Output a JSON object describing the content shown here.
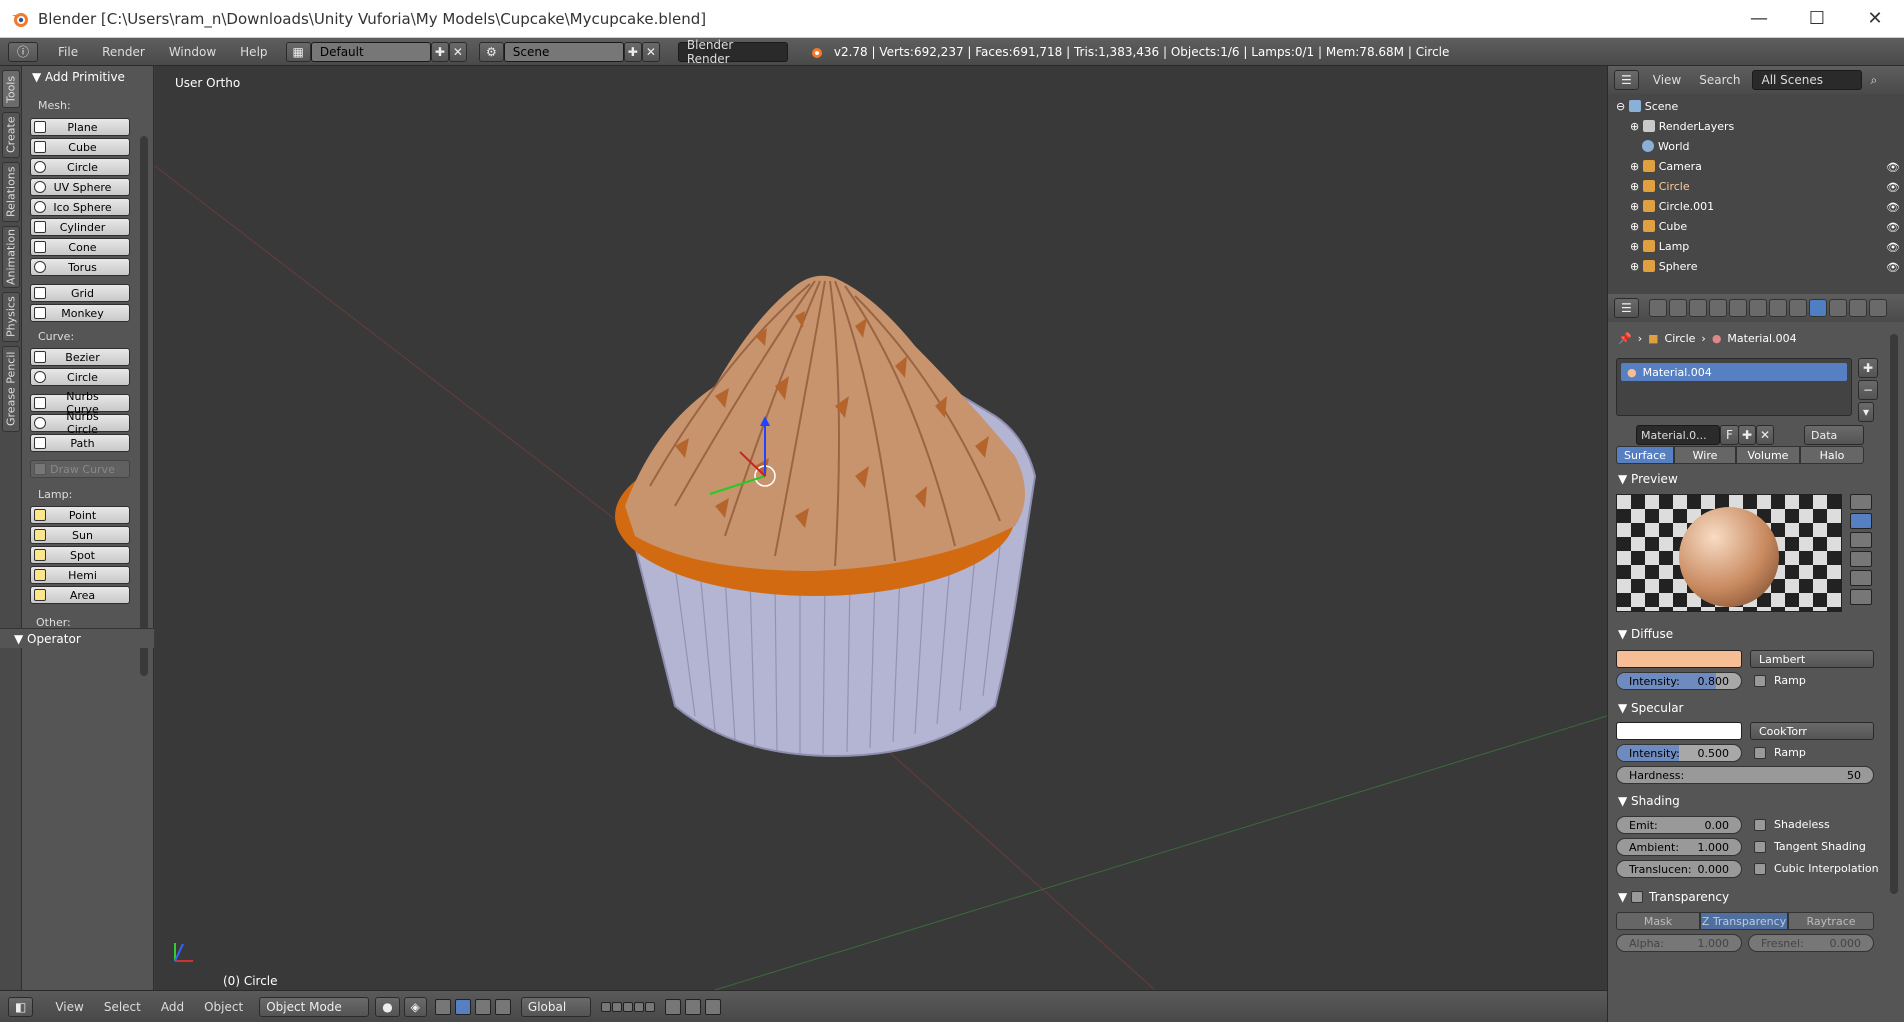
{
  "window": {
    "title": "Blender [C:\\Users\\ram_n\\Downloads\\Unity Vuforia\\My Models\\Cupcake\\Mycupcake.blend]",
    "minimize": "—",
    "maximize": "☐",
    "close": "✕"
  },
  "info_header": {
    "menus": [
      "File",
      "Render",
      "Window",
      "Help"
    ],
    "layout": "Default",
    "scene": "Scene",
    "engine": "Blender Render",
    "stats": "v2.78 | Verts:692,237 | Faces:691,718 | Tris:1,383,436 | Objects:1/6 | Lamps:0/1 | Mem:78.68M | Circle"
  },
  "tool_tabs": [
    "Tools",
    "Create",
    "Relations",
    "Animation",
    "Physics",
    "Grease Pencil"
  ],
  "tool_shelf": {
    "section": "Add Primitive",
    "mesh_label": "Mesh:",
    "mesh": [
      "Plane",
      "Cube",
      "Circle",
      "UV Sphere",
      "Ico Sphere",
      "Cylinder",
      "Cone",
      "Torus",
      "Grid",
      "Monkey"
    ],
    "curve_label": "Curve:",
    "curve": [
      "Bezier",
      "Circle",
      "Nurbs Curve",
      "Nurbs Circle",
      "Path"
    ],
    "draw_curve": "Draw Curve",
    "lamp_label": "Lamp:",
    "lamp": [
      "Point",
      "Sun",
      "Spot",
      "Hemi",
      "Area"
    ],
    "other_label": "Other:",
    "operator": "Operator"
  },
  "viewport": {
    "view_label": "User Ortho",
    "object_label": "(0) Circle"
  },
  "footer": {
    "menus": [
      "View",
      "Select",
      "Add",
      "Object"
    ],
    "mode": "Object Mode",
    "orientation": "Global"
  },
  "outliner": {
    "menus": [
      "View",
      "Search"
    ],
    "scenes": "All Scenes",
    "items": [
      {
        "name": "Scene",
        "color": "#8ab0d8"
      },
      {
        "name": "RenderLayers",
        "color": "#c9c9c9"
      },
      {
        "name": "World",
        "color": "#8ab0d8"
      },
      {
        "name": "Camera",
        "color": "#e0a040"
      },
      {
        "name": "Circle",
        "color": "#e0a040"
      },
      {
        "name": "Circle.001",
        "color": "#e0a040"
      },
      {
        "name": "Cube",
        "color": "#e0a040"
      },
      {
        "name": "Lamp",
        "color": "#e0a040"
      },
      {
        "name": "Sphere",
        "color": "#e0a040"
      }
    ]
  },
  "properties": {
    "breadcrumb_object": "Circle",
    "breadcrumb_material": "Material.004",
    "material_slot": "Material.004",
    "material_field": "Material.0...",
    "fake_user": "F",
    "link": "Data",
    "tabs": [
      "Surface",
      "Wire",
      "Volume",
      "Halo"
    ],
    "preview_title": "Preview",
    "diffuse": {
      "title": "Diffuse",
      "color": "#f7be96",
      "shader": "Lambert",
      "intensity_label": "Intensity:",
      "intensity": "0.800",
      "intensity_fraction": 0.8,
      "ramp": "Ramp"
    },
    "specular": {
      "title": "Specular",
      "color": "#ffffff",
      "shader": "CookTorr",
      "intensity_label": "Intensity:",
      "intensity": "0.500",
      "intensity_fraction": 0.5,
      "ramp": "Ramp",
      "hardness_label": "Hardness:",
      "hardness": "50"
    },
    "shading": {
      "title": "Shading",
      "emit_label": "Emit:",
      "emit": "0.00",
      "ambient_label": "Ambient:",
      "ambient": "1.000",
      "translucency_label": "Translucen:",
      "translucency": "0.000",
      "shadeless": "Shadeless",
      "tangent": "Tangent Shading",
      "cubic": "Cubic Interpolation"
    },
    "transparency": {
      "title": "Transparency",
      "modes": [
        "Mask",
        "Z Transparency",
        "Raytrace"
      ],
      "alpha_label": "Alpha:",
      "alpha": "1.000",
      "fresnel_label": "Fresnel:",
      "fresnel": "0.000"
    }
  }
}
